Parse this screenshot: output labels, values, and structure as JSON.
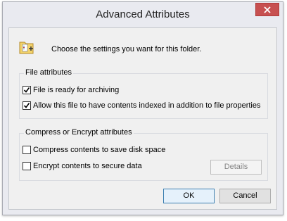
{
  "window": {
    "title": "Advanced Attributes"
  },
  "intro": {
    "text": "Choose the settings you want for this folder."
  },
  "file_attributes": {
    "label": "File attributes",
    "items": [
      {
        "label": "File is ready for archiving",
        "checked": true
      },
      {
        "label": "Allow this file to have contents indexed in addition to file properties",
        "checked": true
      }
    ]
  },
  "compress_encrypt": {
    "label": "Compress or Encrypt attributes",
    "items": [
      {
        "label": "Compress contents to save disk space",
        "checked": false
      },
      {
        "label": "Encrypt contents to secure data",
        "checked": false
      }
    ],
    "details_label": "Details"
  },
  "buttons": {
    "ok": "OK",
    "cancel": "Cancel"
  },
  "colors": {
    "close": "#c75050",
    "accent": "#3c7fb1"
  },
  "icons": {
    "folder": "folder-settings-icon",
    "close": "close-icon"
  }
}
